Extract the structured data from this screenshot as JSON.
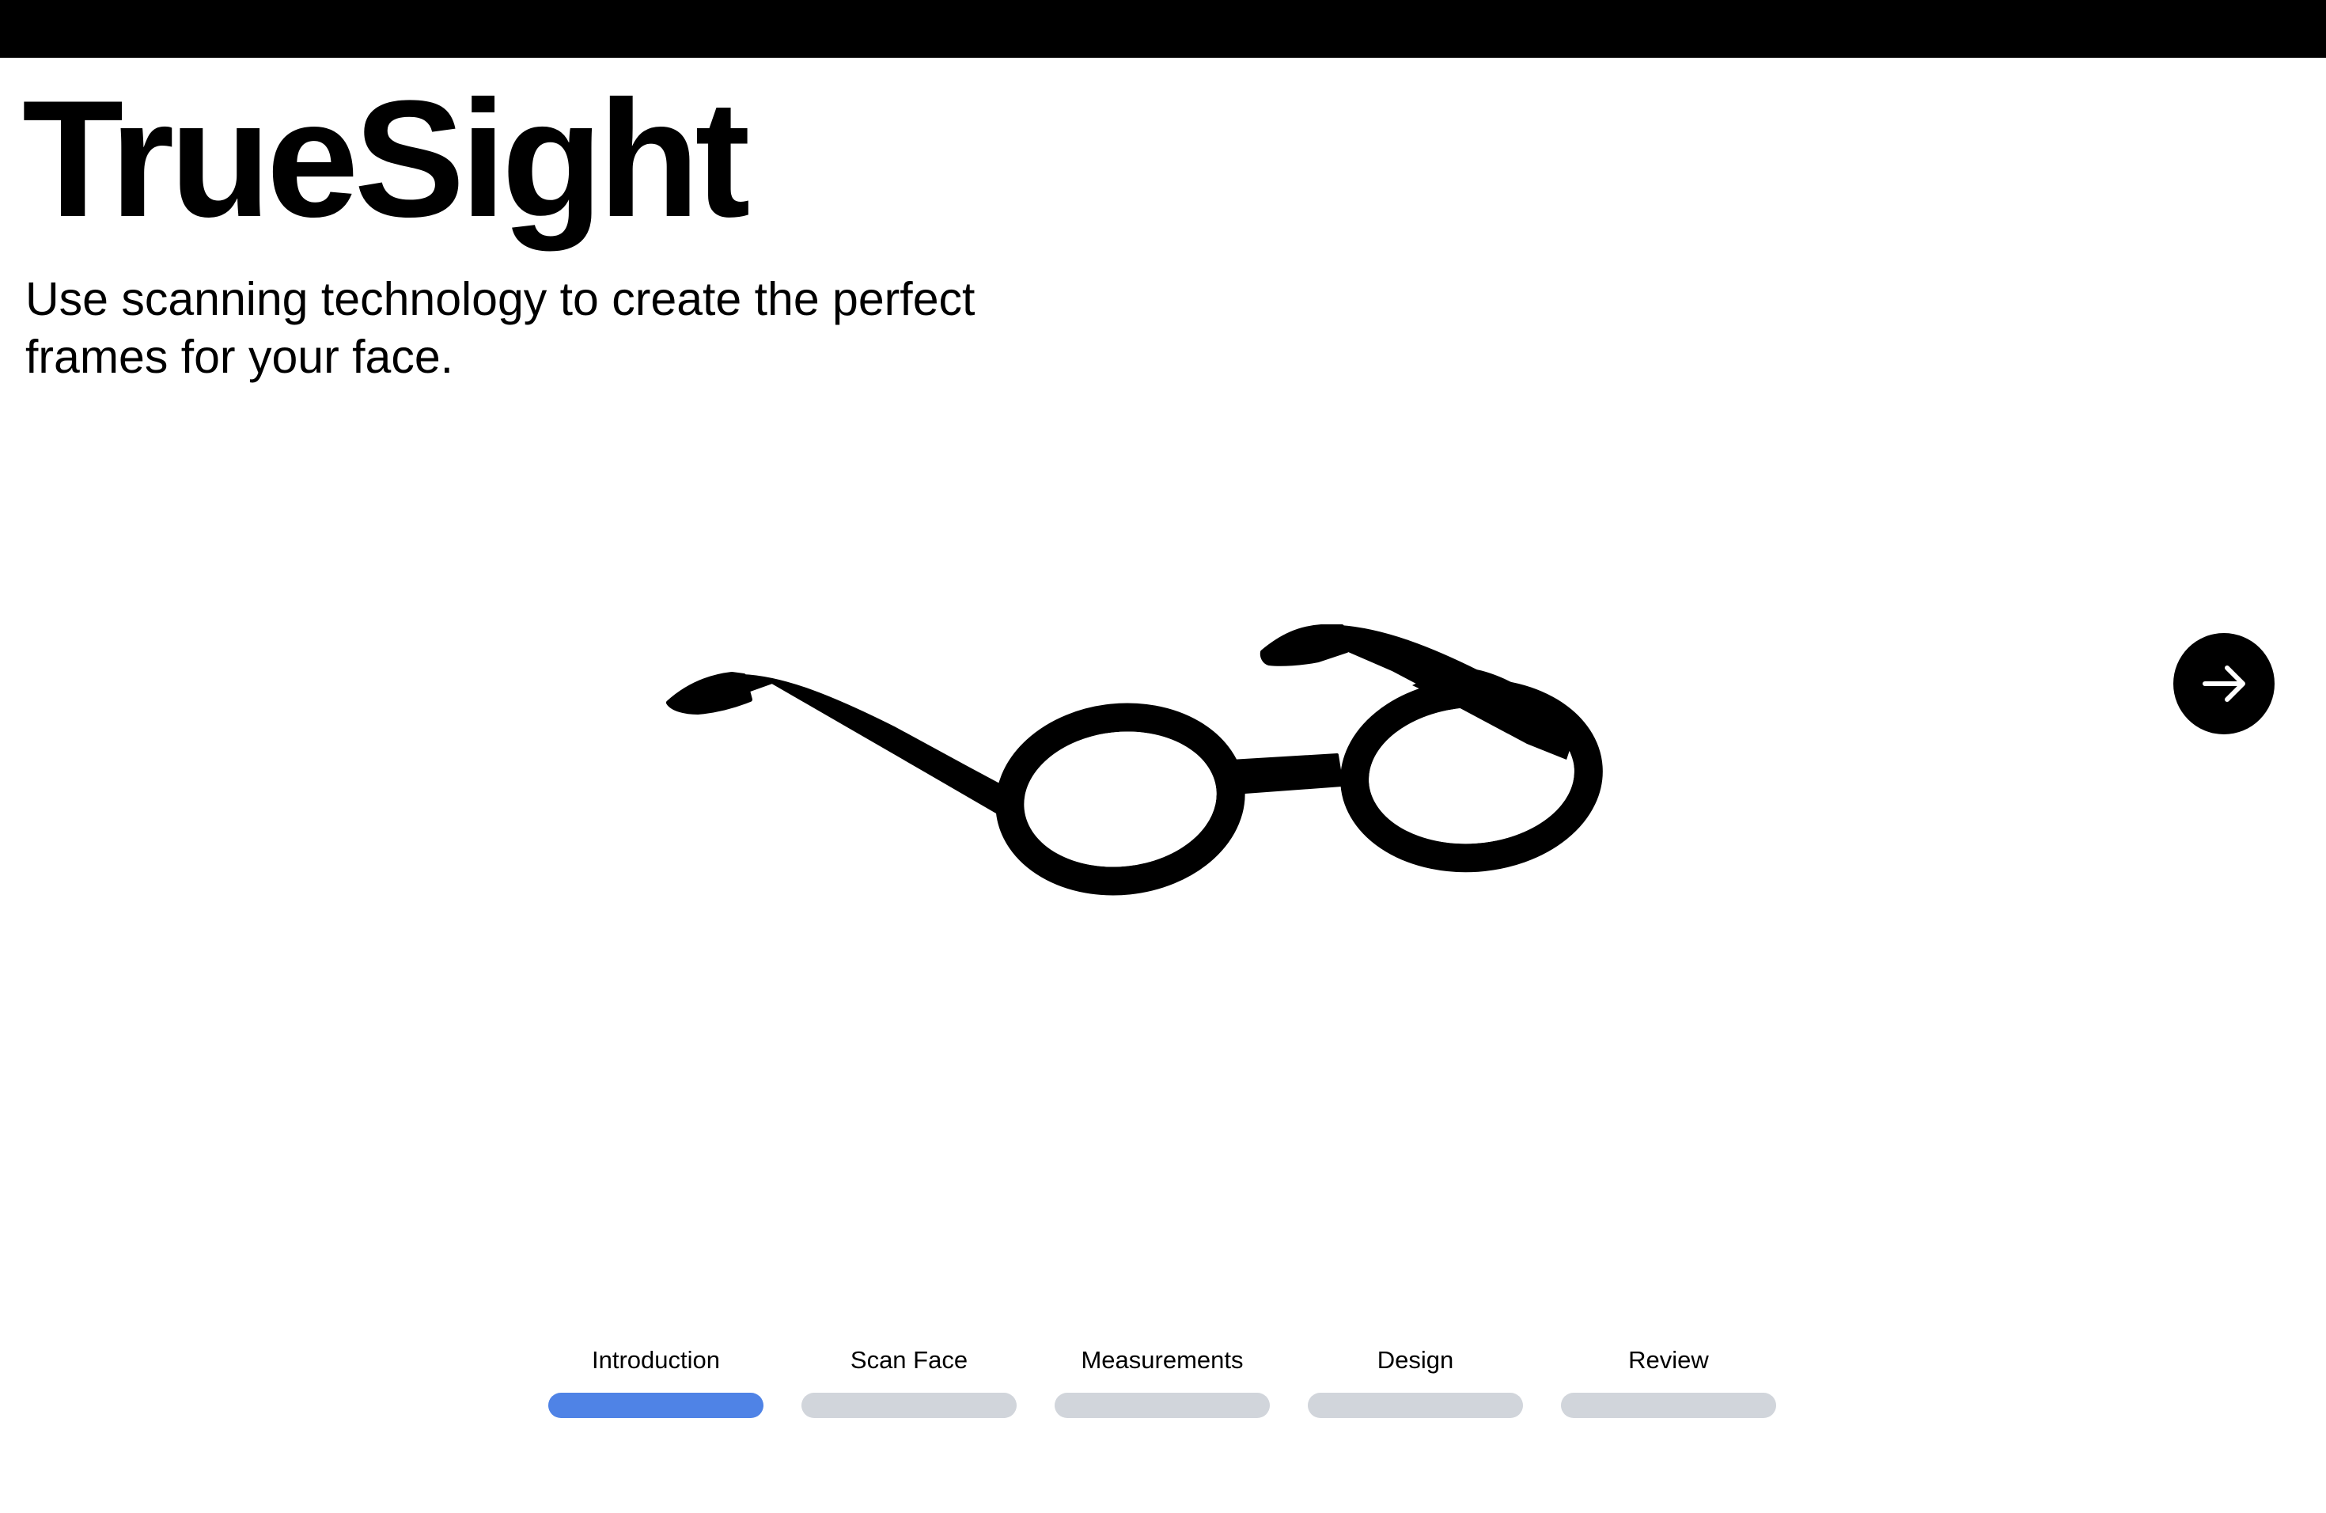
{
  "header": {
    "title": "TrueSight",
    "subtitle": "Use scanning technology to create the perfect frames for your face."
  },
  "hero": {
    "icon": "eyeglasses-icon"
  },
  "navigation": {
    "next_icon": "arrow-right-icon"
  },
  "steps": [
    {
      "label": "Introduction",
      "active": true
    },
    {
      "label": "Scan Face",
      "active": false
    },
    {
      "label": "Measurements",
      "active": false
    },
    {
      "label": "Design",
      "active": false
    },
    {
      "label": "Review",
      "active": false
    }
  ],
  "colors": {
    "top_bar": "#000000",
    "step_active": "#4f83e6",
    "step_inactive": "#d1d5db",
    "button_bg": "#000000",
    "button_icon": "#ffffff"
  }
}
